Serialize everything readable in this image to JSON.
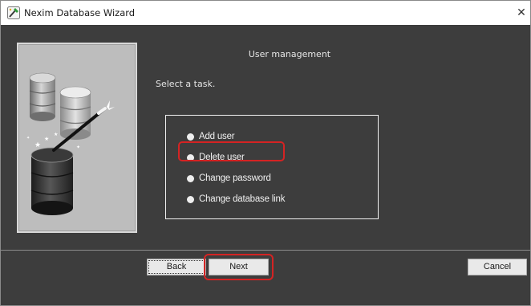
{
  "window": {
    "title": "Nexim Database Wizard",
    "close_symbol": "✕",
    "app_icon": "wizard-wand-icon",
    "close_icon": "close-icon"
  },
  "page": {
    "heading": "User management",
    "instruction": "Select a task."
  },
  "tasks": [
    {
      "label": "Add user"
    },
    {
      "label": "Delete user"
    },
    {
      "label": "Change password"
    },
    {
      "label": "Change database link"
    }
  ],
  "buttons": {
    "back": "Back",
    "next": "Next",
    "cancel": "Cancel"
  },
  "colors": {
    "background": "#3d3d3d",
    "highlight": "#d42323"
  }
}
